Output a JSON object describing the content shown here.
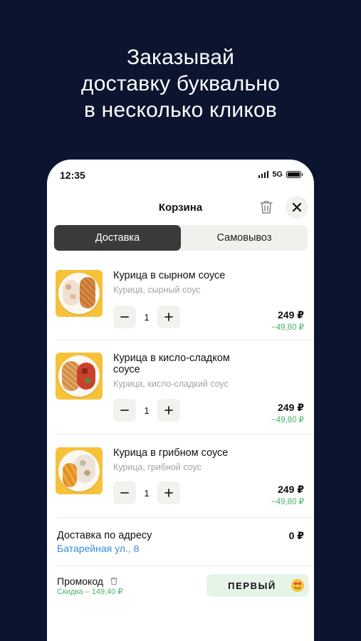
{
  "promo_banner": {
    "line1": "Заказывай",
    "line2": "доставку буквально",
    "line3": "в несколько кликов"
  },
  "status_bar": {
    "time": "12:35",
    "network": "5G"
  },
  "header": {
    "title": "Корзина"
  },
  "tabs": [
    {
      "label": "Доставка",
      "active": true
    },
    {
      "label": "Самовывоз",
      "active": false
    }
  ],
  "cart_items": [
    {
      "name": "Курица в сырном соусе",
      "description": "Курица, сырный соус",
      "quantity": "1",
      "price": "249 ₽",
      "discount": "−49,80 ₽"
    },
    {
      "name": "Курица в кисло-сладком соусе",
      "description": "Курица, кисло-сладкий соус",
      "quantity": "1",
      "price": "249 ₽",
      "discount": "−49,80 ₽"
    },
    {
      "name": "Курица в грибном соусе",
      "description": "Курица, грибной соус",
      "quantity": "1",
      "price": "249 ₽",
      "discount": "−49,80 ₽"
    }
  ],
  "delivery": {
    "label": "Доставка по адресу",
    "address": "Батарейная ул., 8",
    "price": "0 ₽"
  },
  "promo": {
    "label": "Промокод",
    "discount": "Скидка – 149,40 ₽",
    "code": "ПЕРВЫЙ"
  },
  "colors": {
    "background": "#0c1530",
    "active_tab": "#3a3a3a",
    "thumb_bg": "#f7c23a",
    "discount_green": "#46b46a",
    "link_blue": "#3b8be0"
  },
  "icons": [
    "trash-icon",
    "close-icon",
    "minus-icon",
    "plus-icon",
    "smiling-face-with-hearts-icon"
  ]
}
